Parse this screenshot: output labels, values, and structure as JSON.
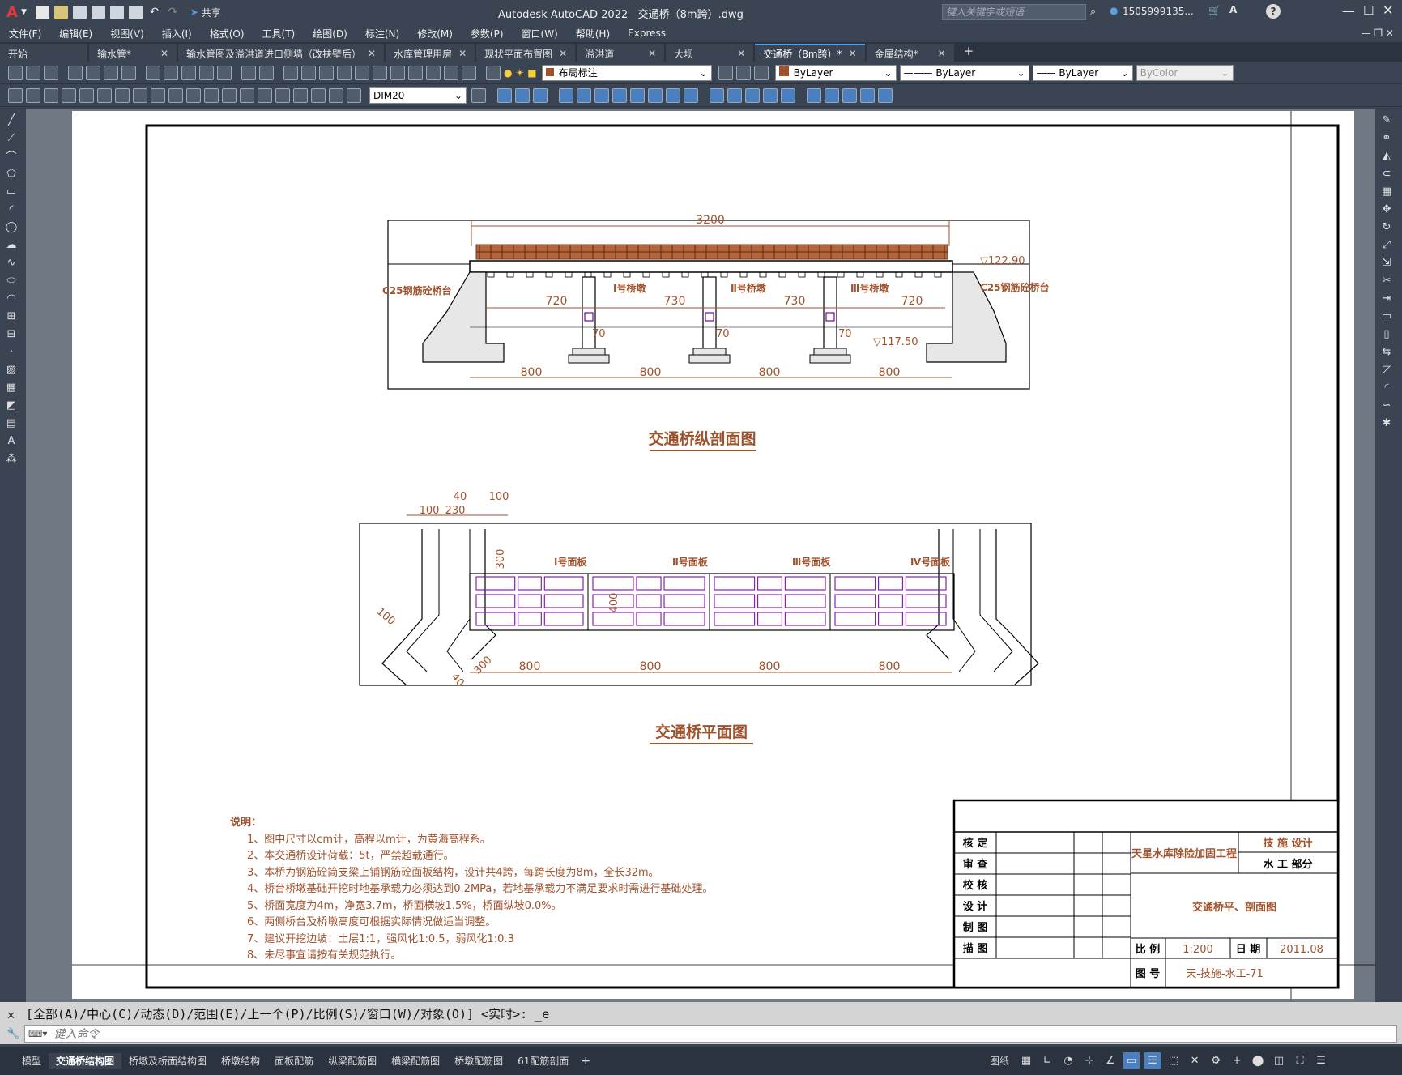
{
  "app": {
    "title": "Autodesk AutoCAD 2022",
    "file": "交通桥（8m跨）.dwg",
    "logo": "A",
    "share_label": "共享"
  },
  "search": {
    "placeholder": "键入关键字或短语"
  },
  "user": {
    "name": "1505999135..."
  },
  "menus": [
    "文件(F)",
    "编辑(E)",
    "视图(V)",
    "插入(I)",
    "格式(O)",
    "工具(T)",
    "绘图(D)",
    "标注(N)",
    "修改(M)",
    "参数(P)",
    "窗口(W)",
    "帮助(H)",
    "Express"
  ],
  "tabs": [
    {
      "label": "开始",
      "closable": false
    },
    {
      "label": "输水管*",
      "closable": true
    },
    {
      "label": "输水管图及溢洪道进口侧墙（改扶壁后）",
      "closable": true
    },
    {
      "label": "水库管理用房",
      "closable": true
    },
    {
      "label": "现状平面布置图",
      "closable": true
    },
    {
      "label": "溢洪道",
      "closable": true
    },
    {
      "label": "大坝",
      "closable": true
    },
    {
      "label": "交通桥（8m跨）*",
      "closable": true,
      "active": true
    },
    {
      "label": "金属结构*",
      "closable": true
    }
  ],
  "toolbar1": {
    "layer": "布局标注",
    "color": "ByLayer",
    "linetype": "ByLayer",
    "lineweight": "ByLayer",
    "plotstyle": "ByColor"
  },
  "toolbar2": {
    "dimstyle": "DIM20"
  },
  "drawing": {
    "long_section": {
      "title": "交通桥纵剖面图",
      "total_length": "3200",
      "elev_top": "▽122.90",
      "elev_bottom": "▽117.50",
      "abutment_left": "C25钢筋砼桥台",
      "abutment_right": "C25钢筋砼桥台",
      "piers": [
        "Ⅰ号桥墩",
        "Ⅱ号桥墩",
        "Ⅲ号桥墩"
      ],
      "spans_upper": [
        "720",
        "730",
        "730",
        "720"
      ],
      "spans_lower": [
        "800",
        "800",
        "800",
        "800"
      ],
      "pier_width": "70"
    },
    "plan": {
      "title": "交通桥平面图",
      "dims_top": [
        "100",
        "230",
        "40",
        "100"
      ],
      "dim_300": "300",
      "dim_400": "400",
      "dim_100": "100",
      "dim_40": "40",
      "panels": [
        "Ⅰ号面板",
        "Ⅱ号面板",
        "Ⅲ号面板",
        "Ⅳ号面板"
      ],
      "spans": [
        "800",
        "800",
        "800",
        "800"
      ]
    },
    "notes": {
      "heading": "说明：",
      "items": [
        "1、图中尺寸以cm计，高程以m计，为黄海高程系。",
        "2、本交通桥设计荷载：5t，严禁超载通行。",
        "3、本桥为钢筋砼简支梁上铺钢筋砼面板结构，设计共4跨，每跨长度为8m，全长32m。",
        "4、桥台桥墩基础开挖时地基承载力必须达到0.2MPa，若地基承载力不满足要求时需进行基础处理。",
        "5、桥面宽度为4m，净宽3.7m，桥面横坡1.5%，桥面纵坡0.0%。",
        "6、两侧桥台及桥墩高度可根据实际情况做适当调整。",
        "7、建议开挖边坡：土层1:1，强风化1:0.5，弱风化1:0.3",
        "8、未尽事宜请按有关规范执行。"
      ]
    },
    "titleblock": {
      "roles": [
        "核 定",
        "审 查",
        "校 核",
        "设 计",
        "制 图",
        "描 图"
      ],
      "project": "天星水库除险加固工程",
      "stage": "技 施  设计",
      "dept": "水 工  部分",
      "drawing_name": "交通桥平、剖面图",
      "scale_label": "比 例",
      "scale": "1:200",
      "date_label": "日 期",
      "date": "2011.08",
      "number_label": "图 号",
      "number": "天-技施-水工-71"
    }
  },
  "command": {
    "history": "[全部(A)/中心(C)/动态(D)/范围(E)/上一个(P)/比例(S)/窗口(W)/对象(O)] <实时>: _e",
    "placeholder": "键入命令"
  },
  "layout_tabs": [
    "模型",
    "交通桥结构图",
    "桥墩及桥面结构图",
    "桥墩结构",
    "面板配筋",
    "纵梁配筋图",
    "横梁配筋图",
    "桥墩配筋图",
    "61配筋剖面"
  ],
  "status": {
    "paper": "图纸"
  }
}
